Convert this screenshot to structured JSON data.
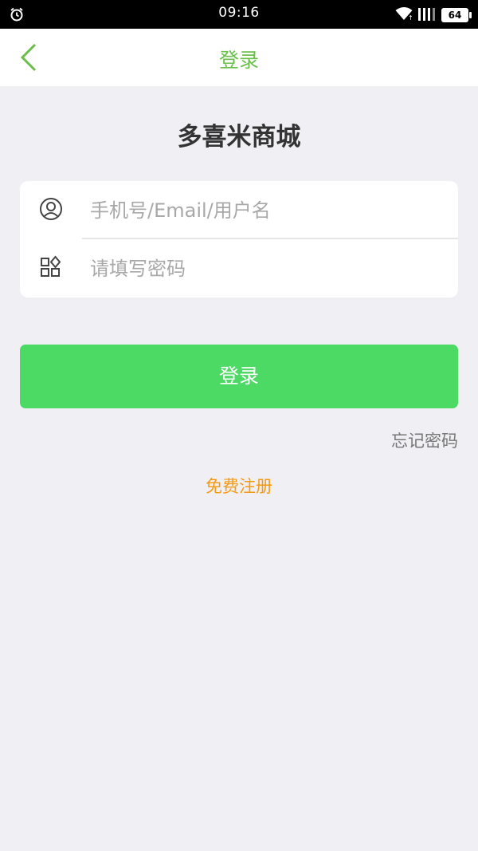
{
  "status_bar": {
    "time": "09:16",
    "battery": "64"
  },
  "header": {
    "title": "登录"
  },
  "brand": {
    "name": "多喜米商城"
  },
  "form": {
    "username_placeholder": "手机号/Email/用户名",
    "password_placeholder": "请填写密码"
  },
  "actions": {
    "login_label": "登录",
    "forgot_label": "忘记密码",
    "register_label": "免费注册"
  },
  "colors": {
    "accent_green": "#4cd964",
    "title_green": "#6abf4b",
    "register_orange": "#f59a10",
    "background": "#efeff4"
  }
}
